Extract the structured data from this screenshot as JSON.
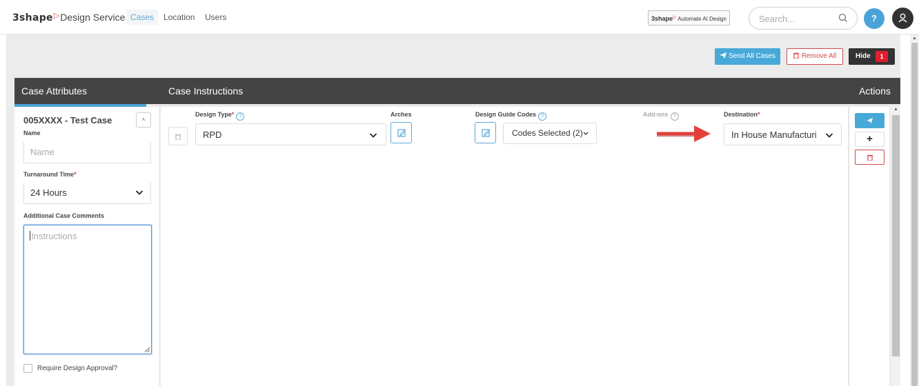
{
  "brand": {
    "logo_text": "3shape",
    "service_text": "Design Service"
  },
  "nav": {
    "items": [
      {
        "label": "Cases",
        "active": true
      },
      {
        "label": "Location",
        "active": false
      },
      {
        "label": "Users",
        "active": false
      }
    ]
  },
  "header_right": {
    "automate_badge": {
      "brand": "3shape",
      "label": "Automate AI Design"
    },
    "search_placeholder": "Search...",
    "help_label": "?"
  },
  "toolbar": {
    "send_all_label": "Send All Cases",
    "remove_all_label": "Remove All",
    "hide_label": "Hide",
    "hide_count": "1"
  },
  "section_headers": {
    "case_attributes": "Case Attributes",
    "case_instructions": "Case Instructions",
    "actions": "Actions"
  },
  "case": {
    "title": "005XXXX - Test Case",
    "name_label": "Name",
    "name_placeholder": "Name",
    "turnaround_label": "Turnaround Time",
    "turnaround_required": "*",
    "turnaround_value": "24 Hours",
    "comments_label": "Additional Case Comments",
    "comments_placeholder": "Instructions",
    "require_approval_label": "Require Design Approval?",
    "require_approval_checked": false
  },
  "instructions": {
    "design_type_label": "Design Type",
    "design_type_required": "*",
    "design_type_value": "RPD",
    "arches_label": "Arches",
    "guide_codes_label": "Design Guide Codes",
    "guide_codes_value": "Codes Selected (2)",
    "addons_label": "Add-ons",
    "destination_label": "Destination",
    "destination_required": "*",
    "destination_value": "In House Manufacturi"
  },
  "colors": {
    "accent": "#4aa3d8",
    "header_bg": "#444444",
    "danger": "#d04848",
    "badge_red": "#e01e2e",
    "annotation_arrow": "#e2413b"
  }
}
